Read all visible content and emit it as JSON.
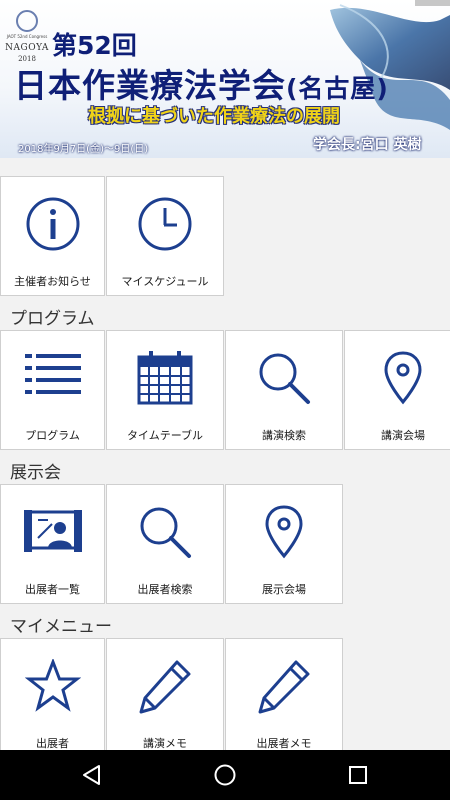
{
  "banner": {
    "logo_small_text": "JAOT 52nd Congress",
    "logo_city": "NAGOYA",
    "logo_year": "2018",
    "line1": "第52回",
    "line2_main": "日本作業療法学会",
    "line2_sub": "(名古屋)",
    "line3": "根拠に基づいた作業療法の展開",
    "date": "2018年9月7日(金)～9日(日)",
    "chair": "学会長:宮口 英樹"
  },
  "top_row": [
    {
      "label": "主催者お知らせ",
      "icon": "info-icon"
    },
    {
      "label": "マイスケジュール",
      "icon": "clock-icon"
    }
  ],
  "sections": {
    "program": {
      "title": "プログラム",
      "items": [
        {
          "label": "プログラム",
          "icon": "list-icon"
        },
        {
          "label": "タイムテーブル",
          "icon": "calendar-icon"
        },
        {
          "label": "講演検索",
          "icon": "search-icon"
        },
        {
          "label": "講演会場",
          "icon": "map-pin-icon"
        }
      ]
    },
    "exhibition": {
      "title": "展示会",
      "items": [
        {
          "label": "出展者一覧",
          "icon": "presentation-icon"
        },
        {
          "label": "出展者検索",
          "icon": "search-icon"
        },
        {
          "label": "展示会場",
          "icon": "map-pin-icon"
        }
      ]
    },
    "mymenu": {
      "title": "マイメニュー",
      "items": [
        {
          "label": "出展者",
          "icon": "star-icon"
        },
        {
          "label": "講演メモ",
          "icon": "pencil-icon"
        },
        {
          "label": "出展者メモ",
          "icon": "pencil-icon"
        }
      ]
    }
  },
  "navbar": {
    "back_icon": "back-triangle-icon",
    "home_icon": "home-circle-icon",
    "recents_icon": "recents-square-icon"
  },
  "colors": {
    "icon_blue": "#1d3f8f",
    "title_navy": "#0f1f77",
    "subtitle_yellow": "#f0d318",
    "tile_border": "#cfcfcf",
    "background": "#f2f2f2"
  }
}
